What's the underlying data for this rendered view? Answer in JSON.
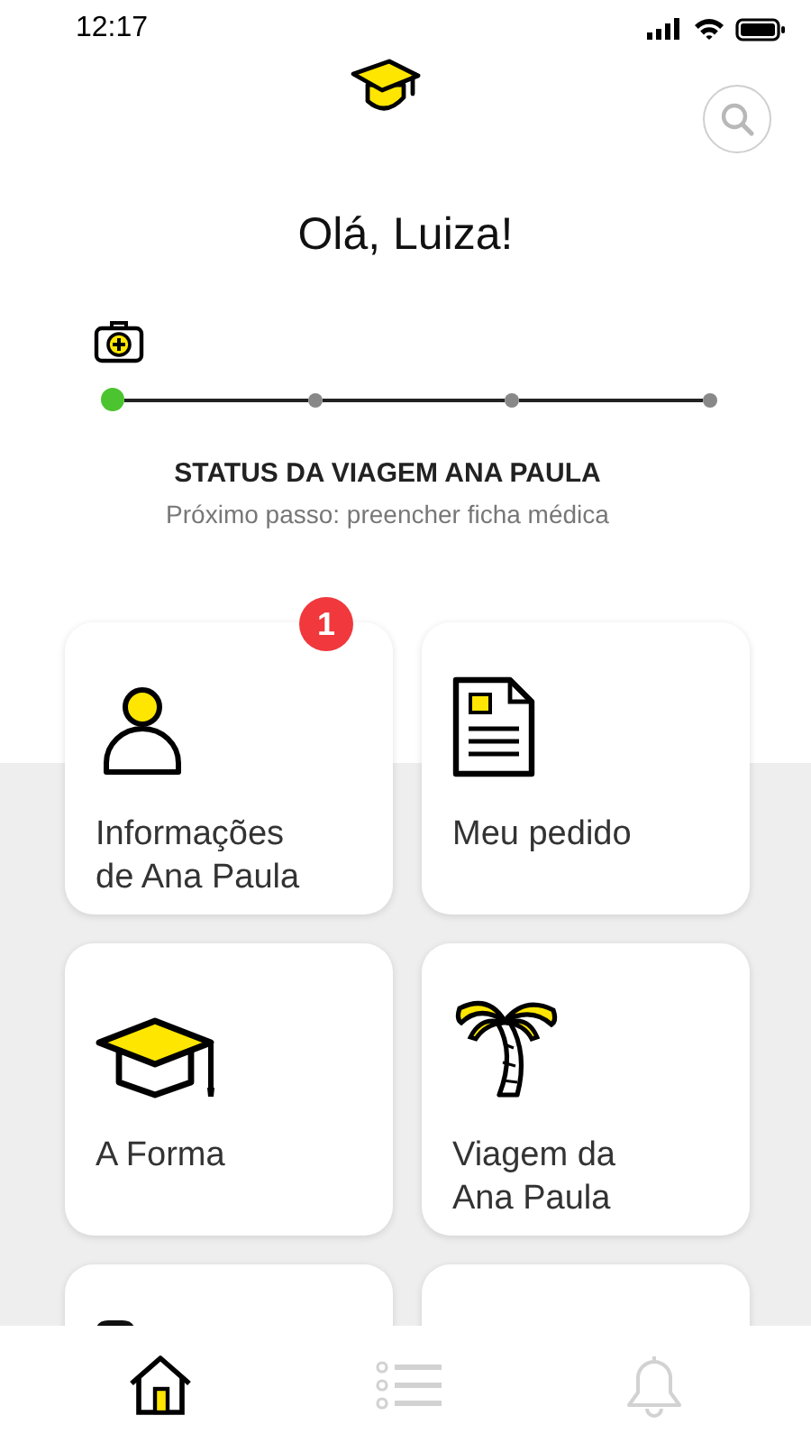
{
  "status_bar": {
    "time": "12:17"
  },
  "greeting": "Olá, Luiza!",
  "progress": {
    "steps": [
      {
        "done": true
      },
      {
        "done": false
      },
      {
        "done": false
      },
      {
        "done": false
      }
    ],
    "title": "STATUS DA VIAGEM ANA PAULA",
    "subtitle": "Próximo passo: preencher ficha médica"
  },
  "cards": [
    {
      "kind": "person",
      "label": "Informações de Ana Paula",
      "badge": "1"
    },
    {
      "kind": "document",
      "label": "Meu pedido"
    },
    {
      "kind": "cap",
      "label": "A Forma"
    },
    {
      "kind": "palm",
      "label": "Viagem da Ana Paula"
    },
    {
      "kind": "partial"
    },
    {
      "kind": "blank"
    }
  ],
  "nav": [
    {
      "kind": "home",
      "selected": true
    },
    {
      "kind": "list",
      "selected": false
    },
    {
      "kind": "bell",
      "selected": false
    }
  ]
}
